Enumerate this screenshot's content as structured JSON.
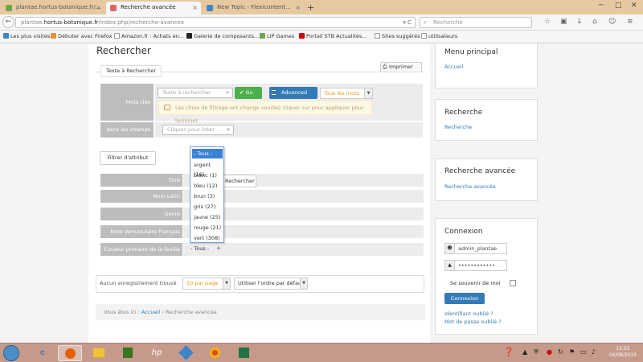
{
  "browser": {
    "tabs": [
      {
        "title": "plantae.hortus-botanique.fr/..."
      },
      {
        "title": "Recherche avancée"
      },
      {
        "title": "New Topic - Flexicontent..."
      }
    ],
    "new_tab": "+",
    "url_prefix": "plantae.",
    "url_host": "hortus-botanique.fr",
    "url_path": "/index.php/recherche-avancee",
    "search_placeholder": "Recherche",
    "bookmarks": [
      "Les plus visités",
      "Débuter avec Firefox",
      "Amazon.fr : Achats en...",
      "Galerie de composants...",
      "LIP Games",
      "Portail STB Actualités...",
      "Sites suggérés",
      "utilisateurs"
    ]
  },
  "main": {
    "title": "Rechercher",
    "print_label": "Imprimer",
    "legend": "Texte à Rechercher",
    "keywords_label": "Mots clés",
    "keywords_placeholder": "Texte à rechercher",
    "go_label": "Go",
    "advanced_label": "Advanced",
    "all_words_label": "Tous les mots",
    "warning_text": "Les choix de filtrage ont changé veuillez cliquer sur pour appliquer pour terminer",
    "fields_label": "dans les champs",
    "fields_placeholder": "Cliquez pour lister",
    "filter_button": "Filtrer d'attribut",
    "attributes": [
      {
        "label": "Titre"
      },
      {
        "label": "Nom Latin"
      },
      {
        "label": "Genre"
      },
      {
        "label": "Nom Vernaculaire Français"
      },
      {
        "label": "Couleur primaire de la feuille"
      }
    ],
    "recherche_fragment": "Rechercher",
    "dropdown": {
      "options": [
        "- Tous -",
        "argent (16)",
        "blanc (1)",
        "bleu (12)",
        "brun (3)",
        "gris (27)",
        "jaune (25)",
        "rouge (21)",
        "vert (308)"
      ],
      "selected": "- Tous -"
    },
    "results_text": "Aucun enregistrement trouvé",
    "per_page": "10 par page",
    "sort": "Utiliser l'ordre par défaut",
    "breadcrumb_prefix": "Vous êtes ici :",
    "breadcrumb_home": "Accueil",
    "breadcrumb_current": "Recherche avancée"
  },
  "sidebar": {
    "menu_title": "Menu principal",
    "menu_link": "Accueil",
    "search_title": "Recherche",
    "search_link": "Recherche",
    "adv_title": "Recherche avancée",
    "adv_link": "Recherche avancée",
    "login_title": "Connexion",
    "username": "admin_plantae",
    "password": "••••••••••••",
    "remember_label": "Se souvenir de moi",
    "login_button": "Connexion",
    "forgot_id": "Identifiant oublié ?",
    "forgot_pw": "Mot de passe oublié ?"
  },
  "taskbar": {
    "clock_time": "13:55",
    "clock_date": "04/08/2015"
  }
}
